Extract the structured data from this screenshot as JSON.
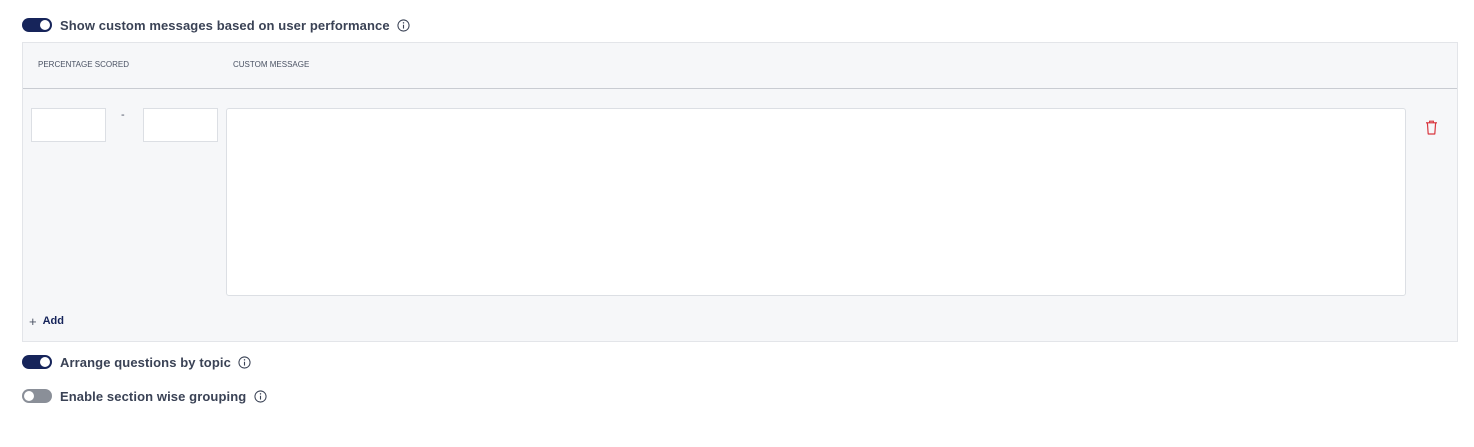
{
  "settings": {
    "custom_messages": {
      "label": "Show custom messages based on user performance",
      "enabled": true,
      "info_icon": "info-circle-icon"
    },
    "arrange_by_topic": {
      "label": "Arrange questions by topic",
      "enabled": true,
      "info_icon": "info-circle-icon"
    },
    "section_grouping": {
      "label": "Enable section wise grouping",
      "enabled": false,
      "info_icon": "info-circle-icon"
    }
  },
  "messages_table": {
    "columns": {
      "percentage": "PERCENTAGE SCORED",
      "message": "CUSTOM MESSAGE"
    },
    "rows": [
      {
        "min": "",
        "max": "",
        "separator": "-",
        "message": "",
        "delete_icon": "trash-icon"
      }
    ],
    "add_label": "Add",
    "add_icon": "plus-icon"
  },
  "colors": {
    "toggle_on": "#16245a",
    "toggle_off": "#8a8f98",
    "delete": "#d9363e",
    "panel_bg": "#f6f7f9"
  }
}
